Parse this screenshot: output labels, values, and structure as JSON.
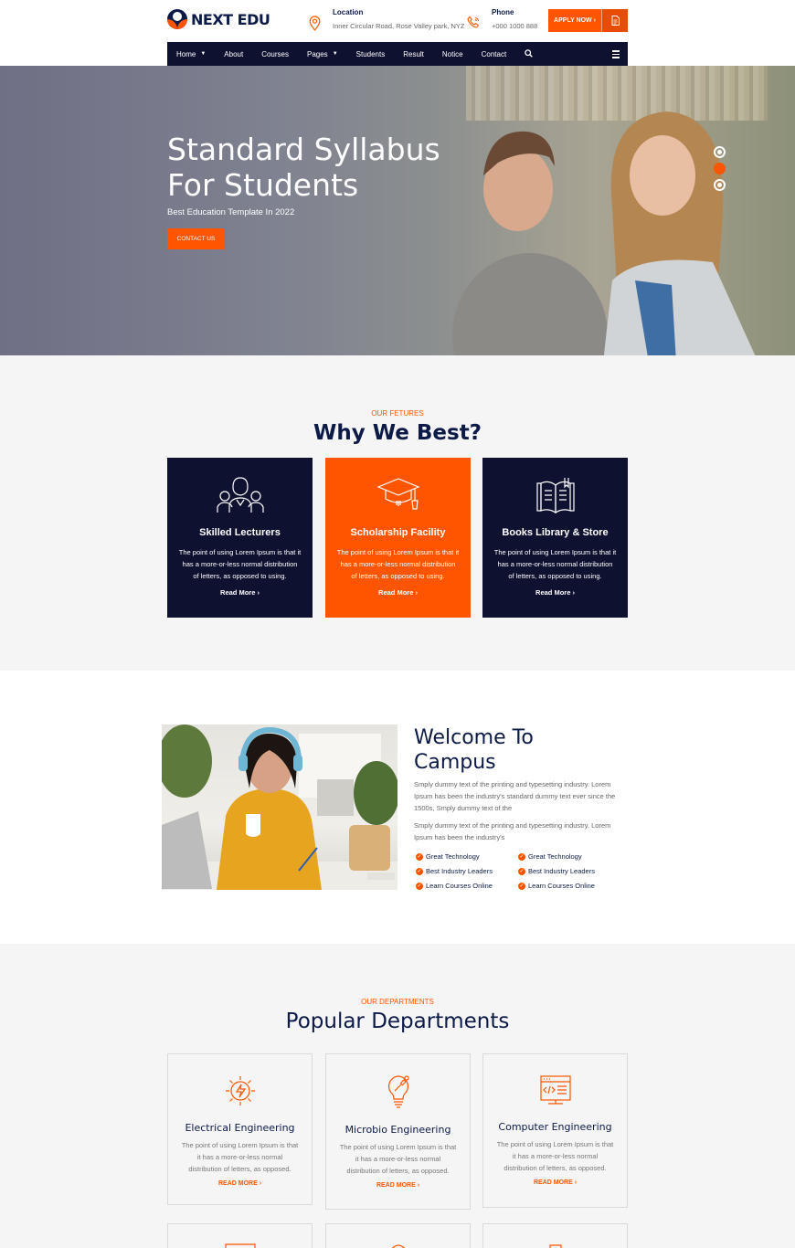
{
  "header": {
    "logo_text": "NEXT EDU",
    "location_label": "Location",
    "location_value": "Inner Circular Road, Rose Valley park, NYZ",
    "phone_label": "Phone",
    "phone_value": "+000 1000 888",
    "apply_label": "APPLY NOW ›"
  },
  "nav": {
    "items": [
      "Home",
      "About",
      "Courses",
      "Pages",
      "Students",
      "Result",
      "Notice",
      "Contact"
    ]
  },
  "hero": {
    "title_line1": "Standard Syllabus",
    "title_line2": "For Students",
    "subtitle": "Best Education Template In 2022",
    "cta": "CONTACT US",
    "active_slide": 2
  },
  "features": {
    "eyebrow": "OUR FETURES",
    "title": "Why We Best?",
    "cards": [
      {
        "icon": "lecturers-icon",
        "title": "Skilled Lecturers",
        "line1": "The point of using Lorem Ipsum is that it",
        "line2": "has a more-or-less normal distribution",
        "line3": "of letters, as opposed to using.",
        "more": "Read More ›"
      },
      {
        "icon": "graduation-cap-icon",
        "title": "Scholarship Facility",
        "line1": "The point of using Lorem Ipsum is that it",
        "line2": "has a more-or-less normal distribution",
        "line3": "of letters, as opposed to using.",
        "more": "Read More ›"
      },
      {
        "icon": "book-icon",
        "title": "Books Library & Store",
        "line1": "The point of using Lorem Ipsum is that it",
        "line2": "has a more-or-less normal distribution",
        "line3": "of letters, as opposed to using.",
        "more": "Read More ›"
      }
    ]
  },
  "welcome": {
    "title_line1": "Welcome To",
    "title_line2": "Campus",
    "p1": "Smply dummy text of the printing and typesetting industry. Lorem Ipsum has been the industry's standard dummy text ever since the 1500s, Smply dummy text of the",
    "p2": "Smply dummy text of the printing and typesetting industry. Lorem Ipsum has been the industry's",
    "checks": [
      "Great Technology",
      "Great Technology",
      "Best Industry Leaders",
      "Best Industry Leaders",
      "Learn Courses Online",
      "Learn Courses Online"
    ]
  },
  "departments": {
    "eyebrow": "OUR DEPARTMENTS",
    "title": "Popular Departments",
    "cards": [
      {
        "icon": "lightning-icon",
        "title": "Electrical Engineering",
        "line1": "The point of using Lorem Ipsum is that",
        "line2": "it has a more-or-less normal",
        "line3": "distribution of letters, as opposed.",
        "more": "READ MORE ›"
      },
      {
        "icon": "bulb-icon",
        "title": "Microbio Engineering",
        "line1": "The point of using Lorem Ipsum is that",
        "line2": "it has a more-or-less normal",
        "line3": "distribution of letters, as opposed.",
        "more": "READ MORE ›"
      },
      {
        "icon": "code-window-icon",
        "title": "Computer Engineering",
        "line1": "The point of using Lorem Ipsum is that",
        "line2": "it has a more-or-less normal",
        "line3": "distribution of letters, as opposed.",
        "more": "READ MORE ›"
      }
    ]
  },
  "colors": {
    "accent": "#ff5500",
    "navy": "#0f1131",
    "heading": "#0c1a47"
  }
}
